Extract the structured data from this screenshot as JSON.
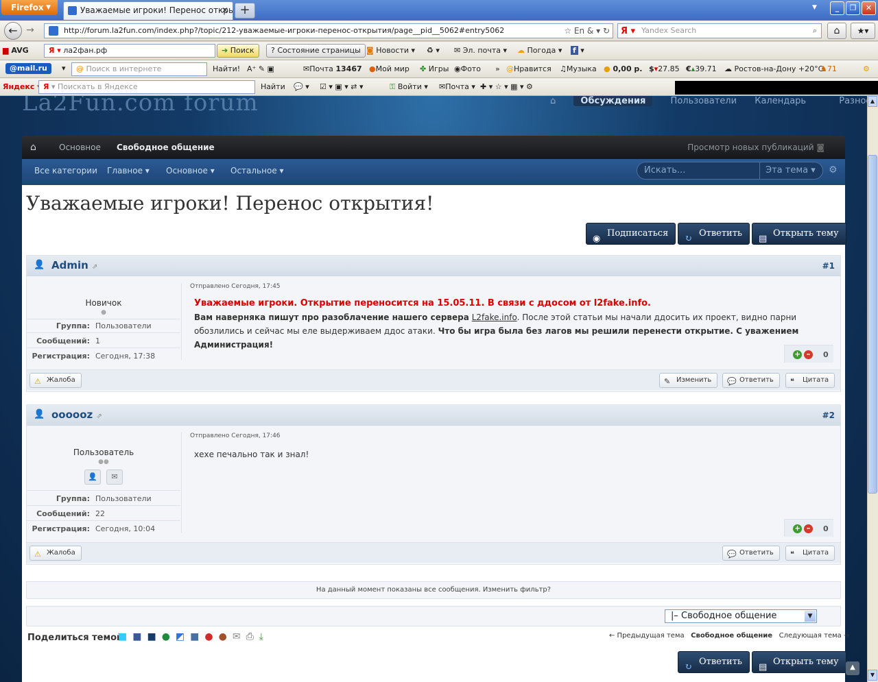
{
  "browser": {
    "firefox_label": "Firefox",
    "tab_title": "Уважаемые игроки! Перенос открытия! - ...",
    "url": "http://forum.la2fun.com/index.php?/topic/212-уважаемые-игроки-перенос-открытия/page__pid__5062#entry5062",
    "yandex_search_placeholder": "Yandex Search"
  },
  "avg_toolbar": {
    "avg_label": "AVG",
    "search_value": "ла2фан.рф",
    "search_button": "Поиск",
    "page_state": "Состояние страницы",
    "news": "Новости",
    "email": "Эл. почта",
    "weather": "Погода"
  },
  "mail_toolbar": {
    "brand": "@mail.ru",
    "search_placeholder": "Поиск в интернете",
    "find": "Найти!",
    "mail_label": "Почта",
    "mail_count": "13467",
    "my_world": "Мой мир",
    "games": "Игры",
    "photo": "Фото",
    "likes": "Нравится",
    "music": "Музыка",
    "balance": "0,00 р.",
    "usd": "27.85",
    "eur": "39.71",
    "weather": "Ростов-на-Дону +20°C",
    "count": "71"
  },
  "yandex_toolbar": {
    "brand": "Яндекс",
    "search_placeholder": "Поискать в Яндексе",
    "find": "Найти",
    "login": "Войти",
    "mail": "Почта"
  },
  "site": {
    "logo": "La2Fun.com forum",
    "topnav": [
      "Обсуждения",
      "Пользователи",
      "Календарь",
      "Разное"
    ],
    "crumbs": [
      "Основное",
      "Свободное общение"
    ],
    "new_pubs": "Просмотр новых публикаций",
    "subnav": [
      "Все категории",
      "Главное",
      "Основное",
      "Остальное"
    ],
    "search_placeholder": "Искать...",
    "search_scope": "Эта тема"
  },
  "topic": {
    "title": "Уважаемые игроки! Перенос открытия!",
    "btn_subscribe": "Подписаться",
    "btn_reply": "Ответить",
    "btn_new_topic": "Открыть тему"
  },
  "posts": [
    {
      "author": "Admin",
      "num": "#1",
      "rank": "Новичок",
      "group_label": "Группа:",
      "group": "Пользователи",
      "posts_label": "Сообщений:",
      "posts": "1",
      "reg_label": "Регистрация:",
      "reg": "Сегодня, 17:38",
      "posted": "Отправлено Сегодня, 17:45",
      "text_red": "Уважаемые игроки. Открытие переносится на 15.05.11. В связи с ддосом от l2fake.info.",
      "text_bold1": "Вам наверняка пишут про разоблачение нашего сервера",
      "text_link": "L2fake.info",
      "text_normal": ". После этой статьи мы начали ддосить их проект, видно парни обозлились и сейчас мы еле выдерживаем ддос атаки.",
      "text_bold2": "Что бы игра была без лагов мы решили перенести открытие. С уважением Администрация!",
      "rep": "0",
      "btn_report": "Жалоба",
      "btn_edit": "Изменить",
      "btn_reply": "Ответить",
      "btn_quote": "Цитата"
    },
    {
      "author": "oooooz",
      "num": "#2",
      "rank": "Пользователь",
      "group_label": "Группа:",
      "group": "Пользователи",
      "posts_label": "Сообщений:",
      "posts": "22",
      "reg_label": "Регистрация:",
      "reg": "Сегодня, 10:04",
      "posted": "Отправлено Сегодня, 17:46",
      "text": "хехе печально так и знал!",
      "rep": "0",
      "btn_report": "Жалоба",
      "btn_reply": "Ответить",
      "btn_quote": "Цитата"
    }
  ],
  "filter_note": "На данный момент показаны все сообщения. Изменить фильтр?",
  "jump_select": "|– Свободное общение",
  "share_label": "Поделиться темой:",
  "prev_topic": "← Предыдущая тема",
  "forum_link": "Свободное общение",
  "next_topic": "Следующая тема →",
  "colors": {
    "accent": "#1f4d80",
    "alert": "#d00000",
    "button_dark": "#172d48"
  }
}
